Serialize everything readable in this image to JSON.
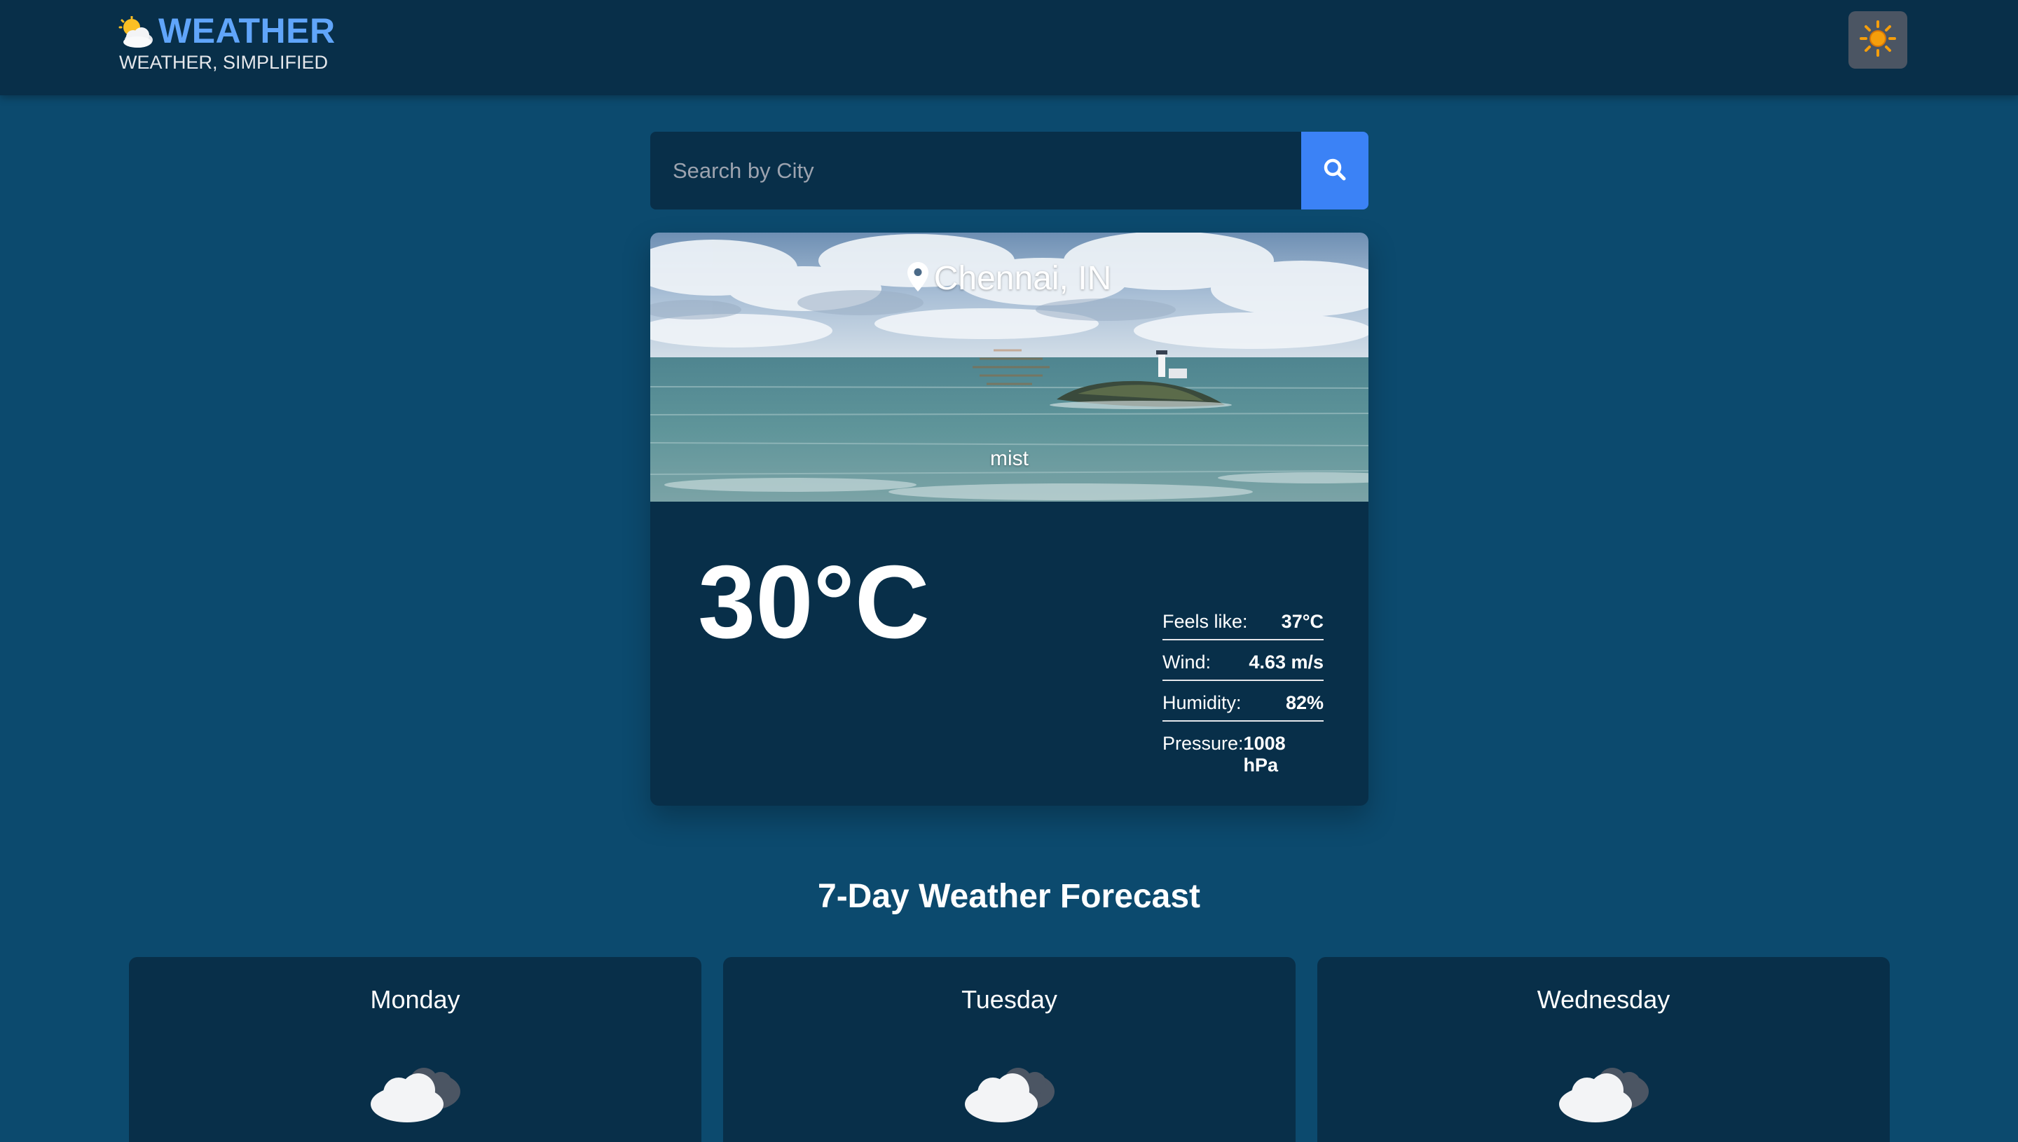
{
  "header": {
    "brand_title": "WEATHER",
    "brand_subtitle": "WEATHER, SIMPLIFIED",
    "logo_icon": "sun-behind-cloud-icon",
    "theme_toggle_icon": "sun-icon"
  },
  "search": {
    "placeholder": "Search by City",
    "value": "",
    "button_icon": "search-icon"
  },
  "current": {
    "location": "Chennai, IN",
    "condition": "mist",
    "temperature": "30°C",
    "details": [
      {
        "label": "Feels like:",
        "value": "37°C"
      },
      {
        "label": "Wind:",
        "value": "4.63 m/s"
      },
      {
        "label": "Humidity:",
        "value": "82%"
      },
      {
        "label": "Pressure:",
        "value": "1008 hPa"
      }
    ]
  },
  "forecast": {
    "title": "7-Day Weather Forecast",
    "days": [
      {
        "day": "Monday",
        "icon": "cloudy-icon"
      },
      {
        "day": "Tuesday",
        "icon": "cloudy-icon"
      },
      {
        "day": "Wednesday",
        "icon": "cloudy-icon"
      }
    ]
  },
  "colors": {
    "page_bg": "#0c4a6e",
    "panel_bg": "#082f49",
    "accent": "#3b82f6",
    "brand": "#60a5fa",
    "sun": "#f59e0b"
  }
}
